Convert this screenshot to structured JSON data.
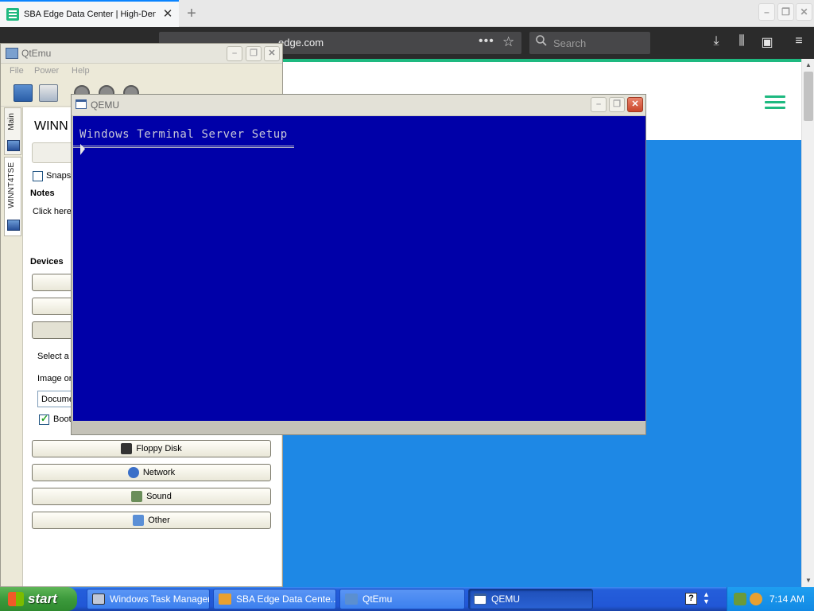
{
  "firefox": {
    "tab_title": "SBA Edge Data Center | High-Dens",
    "newtab_glyph": "+",
    "tab_close_glyph": "✕",
    "url": "edge.com",
    "page_actions_glyph": "•••",
    "search_placeholder": "Search",
    "colors": {
      "site_accent": "#1eb980",
      "site_blue": "#1e88e5",
      "chrome": "#2b2b2b"
    }
  },
  "qtemu": {
    "title": "QtEmu",
    "menus": [
      "File",
      "Power",
      "Help"
    ],
    "tabs": [
      "Main",
      "WINNT4TSE"
    ],
    "machine_heading": "WINN",
    "snapshot_label": "Snapsl",
    "notes_heading": "Notes",
    "notes_text": "Click here",
    "devices_heading": "Devices",
    "select_text": "Select a",
    "image_text": "Image or",
    "combo_value": "Docume",
    "boot_label": "Boot",
    "device_buttons": [
      "Floppy Disk",
      "Network",
      "Sound",
      "Other"
    ]
  },
  "qemu": {
    "title": "QEMU",
    "screen_text": "Windows Terminal Server Setup",
    "screen_color": "#0000a8"
  },
  "taskbar": {
    "start_label": "start",
    "tasks": [
      "Windows Task Manager",
      "SBA Edge Data Cente...",
      "QtEmu",
      "QEMU"
    ],
    "active_task": "QEMU",
    "help_glyph": "?",
    "clock": "7:14 AM"
  }
}
